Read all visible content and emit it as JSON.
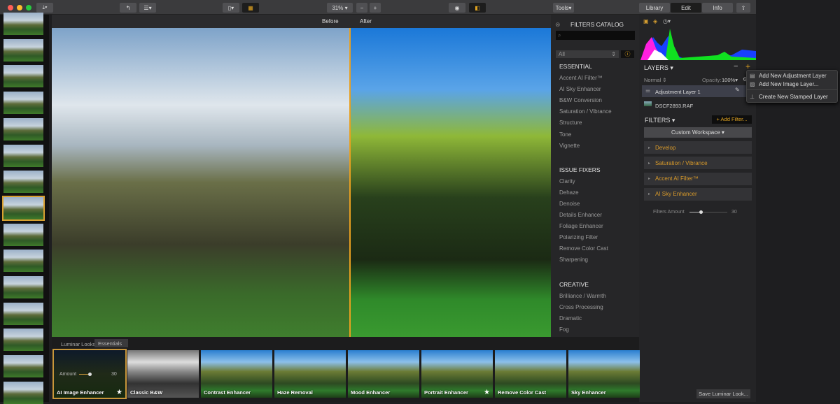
{
  "toolbar": {
    "zoom": "31%",
    "tools": "Tools",
    "tabs": [
      "Library",
      "Edit",
      "Info"
    ],
    "active_tab": "Edit"
  },
  "compare": {
    "before": "Before",
    "after": "After"
  },
  "catalog": {
    "title": "FILTERS CATALOG",
    "search_placeholder": "",
    "category": "All",
    "sections": [
      {
        "title": "ESSENTIAL",
        "items": [
          "Accent AI Filter™",
          "AI Sky Enhancer",
          "B&W Conversion",
          "Saturation / Vibrance",
          "Structure",
          "Tone",
          "Vignette"
        ]
      },
      {
        "title": "ISSUE FIXERS",
        "items": [
          "Clarity",
          "Dehaze",
          "Denoise",
          "Details Enhancer",
          "Foliage Enhancer",
          "Polarizing Filter",
          "Remove Color Cast",
          "Sharpening"
        ]
      },
      {
        "title": "CREATIVE",
        "items": [
          "Brilliance / Warmth",
          "Cross Processing",
          "Dramatic",
          "Fog"
        ]
      }
    ]
  },
  "layers": {
    "title": "LAYERS",
    "blend": "Normal",
    "opacity_label": "Opacity:",
    "opacity": "100%",
    "items": [
      "Adjustment Layer 1",
      "DSCF2893.RAF"
    ]
  },
  "menu": {
    "items": [
      "Add New Adjustment Layer",
      "Add New Image Layer...",
      "Create New Stamped Layer"
    ]
  },
  "filters": {
    "title": "FILTERS",
    "add": "+ Add Filter...",
    "workspace": "Custom Workspace",
    "items": [
      "Develop",
      "Saturation / Vibrance",
      "Accent AI Filter™",
      "AI Sky Enhancer"
    ],
    "amount_label": "Filters Amount",
    "amount": "30",
    "amount_fraction": 0.3
  },
  "looks": {
    "label": "Luminar Looks:",
    "set": "Essentials",
    "amount_label": "Amount",
    "amount": "30",
    "items": [
      {
        "name": "AI Image Enhancer",
        "star": true
      },
      {
        "name": "Classic B&W",
        "star": false
      },
      {
        "name": "Contrast Enhancer",
        "star": false
      },
      {
        "name": "Haze Removal",
        "star": false
      },
      {
        "name": "Mood Enhancer",
        "star": false
      },
      {
        "name": "Portrait Enhancer",
        "star": true
      },
      {
        "name": "Remove Color Cast",
        "star": false
      },
      {
        "name": "Sky Enhancer",
        "star": false
      }
    ],
    "save": "Save Luminar Look..."
  },
  "colors": {
    "accent": "#e0a320",
    "filter_label": "#d89a2a"
  }
}
